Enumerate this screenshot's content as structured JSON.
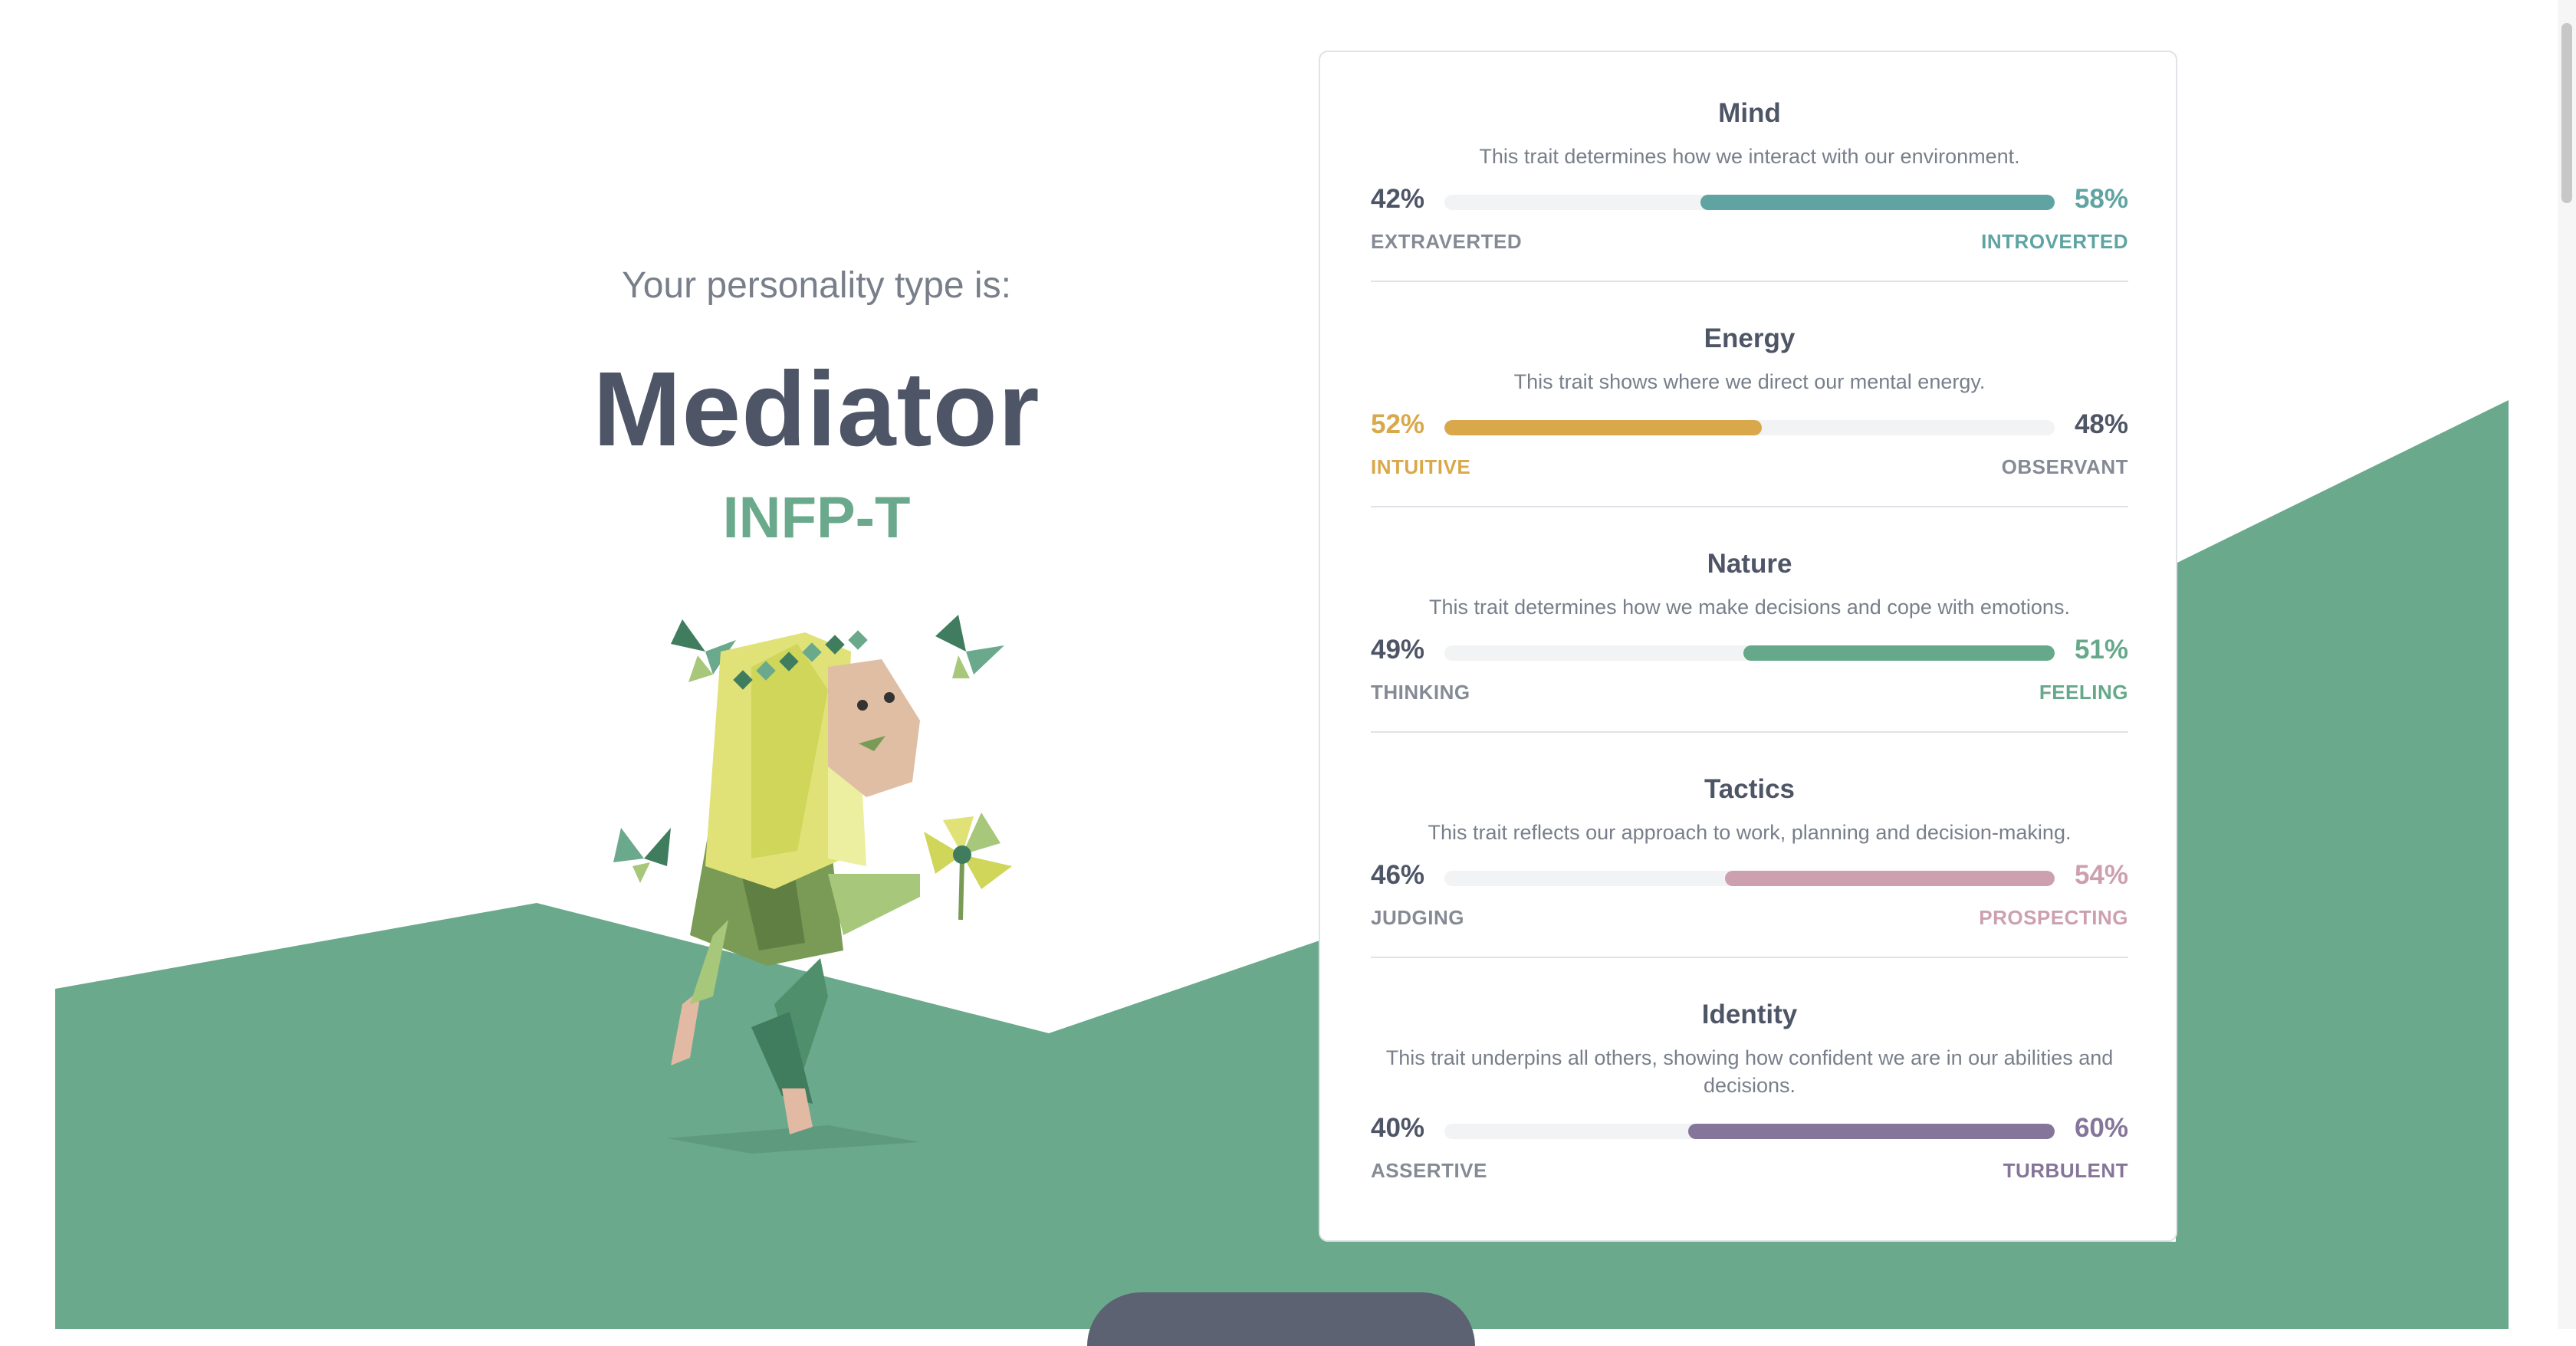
{
  "result": {
    "subtitle": "Your personality type is:",
    "type_name": "Mediator",
    "type_code": "INFP-T"
  },
  "traits": [
    {
      "title": "Mind",
      "description": "This trait determines how we interact with our environment.",
      "left_percent": "42%",
      "right_percent": "58%",
      "left_label": "EXTRAVERTED",
      "right_label": "INTROVERTED",
      "dominant": "right",
      "fill_value": 58,
      "color": "#5fa4a2"
    },
    {
      "title": "Energy",
      "description": "This trait shows where we direct our mental energy.",
      "left_percent": "52%",
      "right_percent": "48%",
      "left_label": "INTUITIVE",
      "right_label": "OBSERVANT",
      "dominant": "left",
      "fill_value": 52,
      "color": "#d9a84a"
    },
    {
      "title": "Nature",
      "description": "This trait determines how we make decisions and cope with emotions.",
      "left_percent": "49%",
      "right_percent": "51%",
      "left_label": "THINKING",
      "right_label": "FEELING",
      "dominant": "right",
      "fill_value": 51,
      "color": "#65a88a"
    },
    {
      "title": "Tactics",
      "description": "This trait reflects our approach to work, planning and decision-making.",
      "left_percent": "46%",
      "right_percent": "54%",
      "left_label": "JUDGING",
      "right_label": "PROSPECTING",
      "dominant": "right",
      "fill_value": 54,
      "color": "#cda0b0"
    },
    {
      "title": "Identity",
      "description": "This trait underpins all others, showing how confident we are in our abilities and decisions.",
      "left_percent": "40%",
      "right_percent": "60%",
      "left_label": "ASSERTIVE",
      "right_label": "TURBULENT",
      "dominant": "right",
      "fill_value": 60,
      "color": "#86759a"
    }
  ],
  "colors": {
    "background_green": "#6aa98c",
    "heading": "#4e5566",
    "muted_text": "#787f8a"
  },
  "icons": {
    "character": "mediator-character-illustration"
  }
}
